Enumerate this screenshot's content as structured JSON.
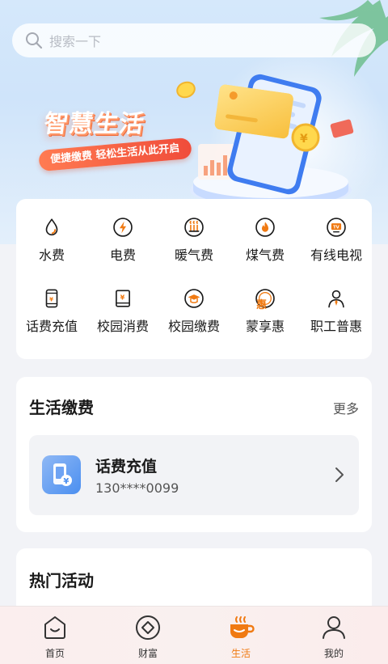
{
  "search": {
    "placeholder": "搜索一下"
  },
  "banner": {
    "slogan": "智慧生活",
    "tagline": "便捷缴费  轻松生活从此开启"
  },
  "services": [
    {
      "label": "水费",
      "icon": "water-drop-icon"
    },
    {
      "label": "电费",
      "icon": "lightning-icon"
    },
    {
      "label": "暖气费",
      "icon": "heater-icon"
    },
    {
      "label": "煤气费",
      "icon": "flame-icon"
    },
    {
      "label": "有线电视",
      "icon": "tv-icon"
    },
    {
      "label": "话费充值",
      "icon": "phone-recharge-icon"
    },
    {
      "label": "校园消费",
      "icon": "campus-spend-icon"
    },
    {
      "label": "校园缴费",
      "icon": "graduation-cap-icon"
    },
    {
      "label": "蒙享惠",
      "icon": "hui-badge-icon"
    },
    {
      "label": "职工普惠",
      "icon": "employee-icon"
    }
  ],
  "life_payment": {
    "title": "生活缴费",
    "more": "更多",
    "item": {
      "title": "话费充值",
      "number": "130****0099",
      "icon": "phone-yuan-icon"
    }
  },
  "hot_activities": {
    "title": "热门活动"
  },
  "tabbar": {
    "active_color": "#f07a12",
    "tabs": [
      {
        "label": "首页",
        "icon": "home-icon"
      },
      {
        "label": "财富",
        "icon": "wealth-icon"
      },
      {
        "label": "生活",
        "icon": "coffee-cup-icon",
        "active": true
      },
      {
        "label": "我的",
        "icon": "user-icon"
      }
    ]
  },
  "colors": {
    "accent_orange": "#f07a12",
    "icon_stroke": "#1a1a1a"
  }
}
